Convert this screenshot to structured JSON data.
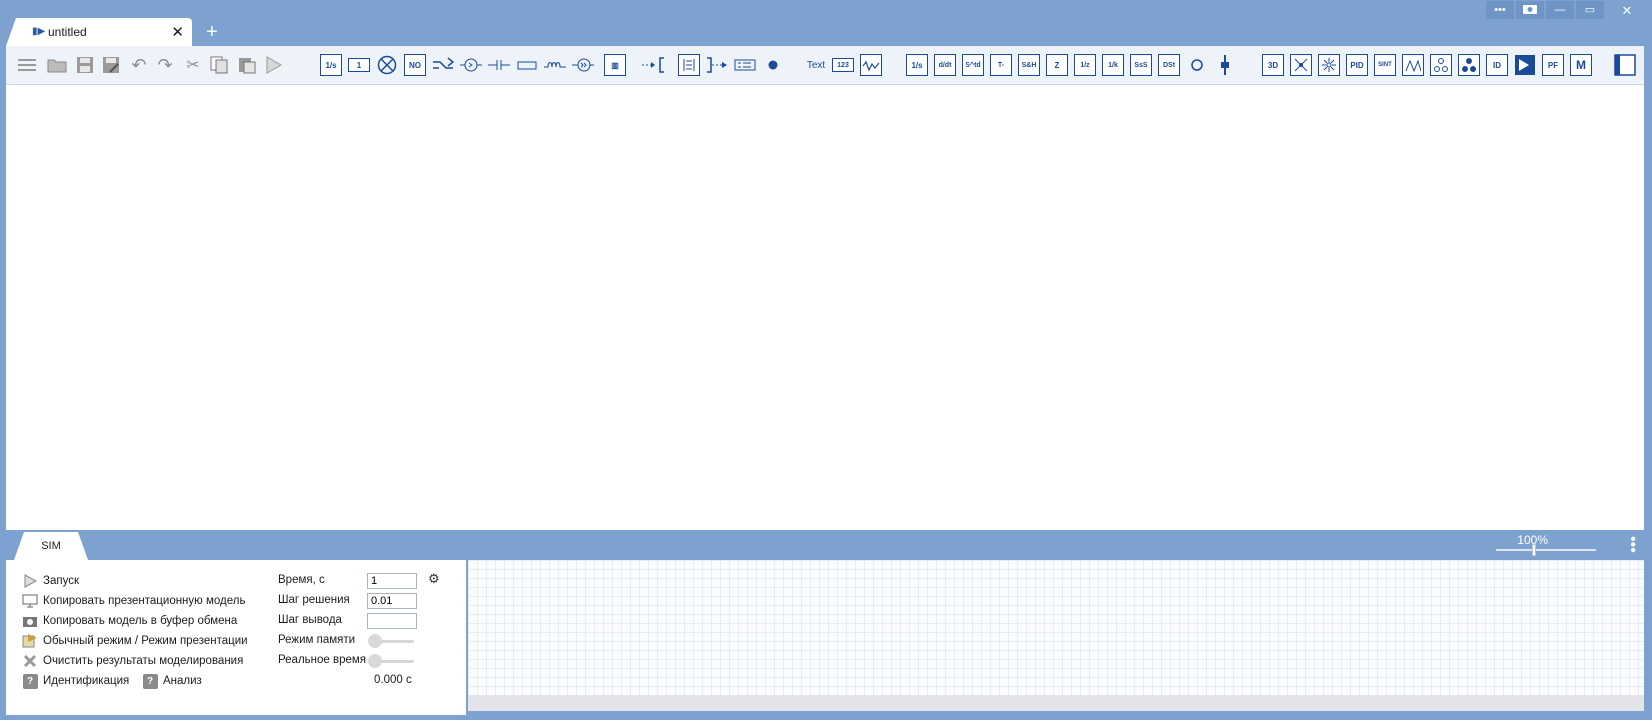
{
  "window_controls": {
    "more": "•••",
    "minimize": "—",
    "restore": "▭",
    "close": "✕"
  },
  "tabs": [
    {
      "title": "untitled",
      "close": "✕"
    }
  ],
  "tab_add": "+",
  "toolbar": {
    "text_label": "Text",
    "num_label": "123",
    "boxed": {
      "integrator": "1/s",
      "gain": "1",
      "not": "NO",
      "mux": "▥",
      "derivative": "d/dt",
      "std": "S^td",
      "flags": "T-",
      "sh": "S&H",
      "z": "Z",
      "tz": "1/z",
      "sat": "1/k",
      "sts": "SsS",
      "dst": "DSt",
      "threed": "3D",
      "pid": "PID",
      "sint": "SINT",
      "id": "ID",
      "pf": "PF",
      "m": "M"
    }
  },
  "bottom": {
    "sim_tab": "SIM",
    "zoom": "100%"
  },
  "sim_panel": {
    "commands": [
      {
        "label": "Запуск",
        "icon": "play-icon"
      },
      {
        "label": "Копировать презентационную модель",
        "icon": "presentation-icon"
      },
      {
        "label": "Копировать модель в буфер обмена",
        "icon": "camera-icon"
      },
      {
        "label": "Обычный режим / Режим презентации",
        "icon": "mode-icon"
      },
      {
        "label": "Очистить результаты моделирования",
        "icon": "clear-icon"
      }
    ],
    "identification": "Идентификация",
    "analysis": "Анализ",
    "help_badge": "?",
    "params": {
      "time_label": "Время, с",
      "time_value": "1",
      "step_label": "Шаг решения",
      "step_value": "0.01",
      "output_step_label": "Шаг вывода",
      "output_step_value": "",
      "memory_mode_label": "Режим памяти",
      "realtime_label": "Реальное время"
    },
    "current_time": "0.000 с"
  }
}
